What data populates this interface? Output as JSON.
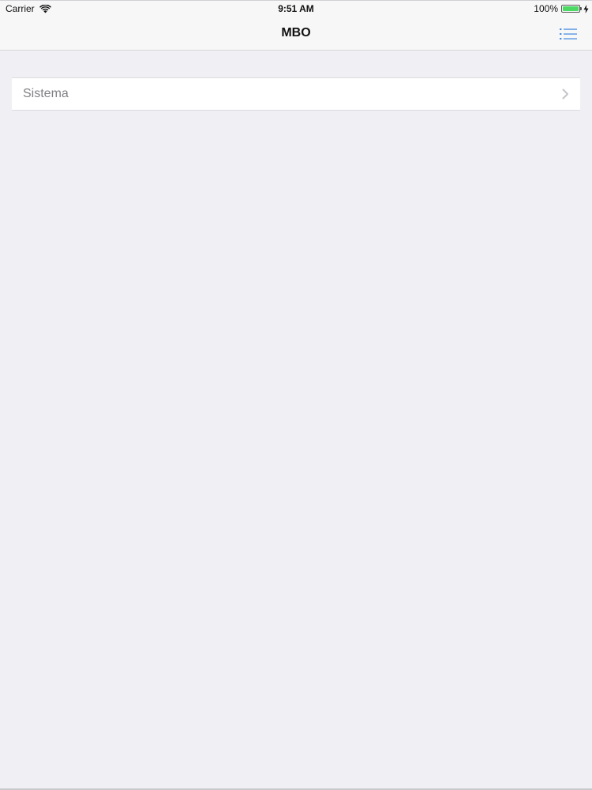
{
  "status_bar": {
    "carrier": "Carrier",
    "time": "9:51 AM",
    "battery": "100%",
    "battery_level": 1.0,
    "icons": [
      "wifi-icon",
      "battery-icon",
      "charging-icon"
    ],
    "battery_color": "#4cd964"
  },
  "nav": {
    "title": "MBO",
    "menu_icon": "list-menu-icon",
    "accent_color": "#4a90e2"
  },
  "list": {
    "items": [
      {
        "label": "Sistema",
        "accessory_icon": "chevron-right-icon"
      }
    ]
  }
}
